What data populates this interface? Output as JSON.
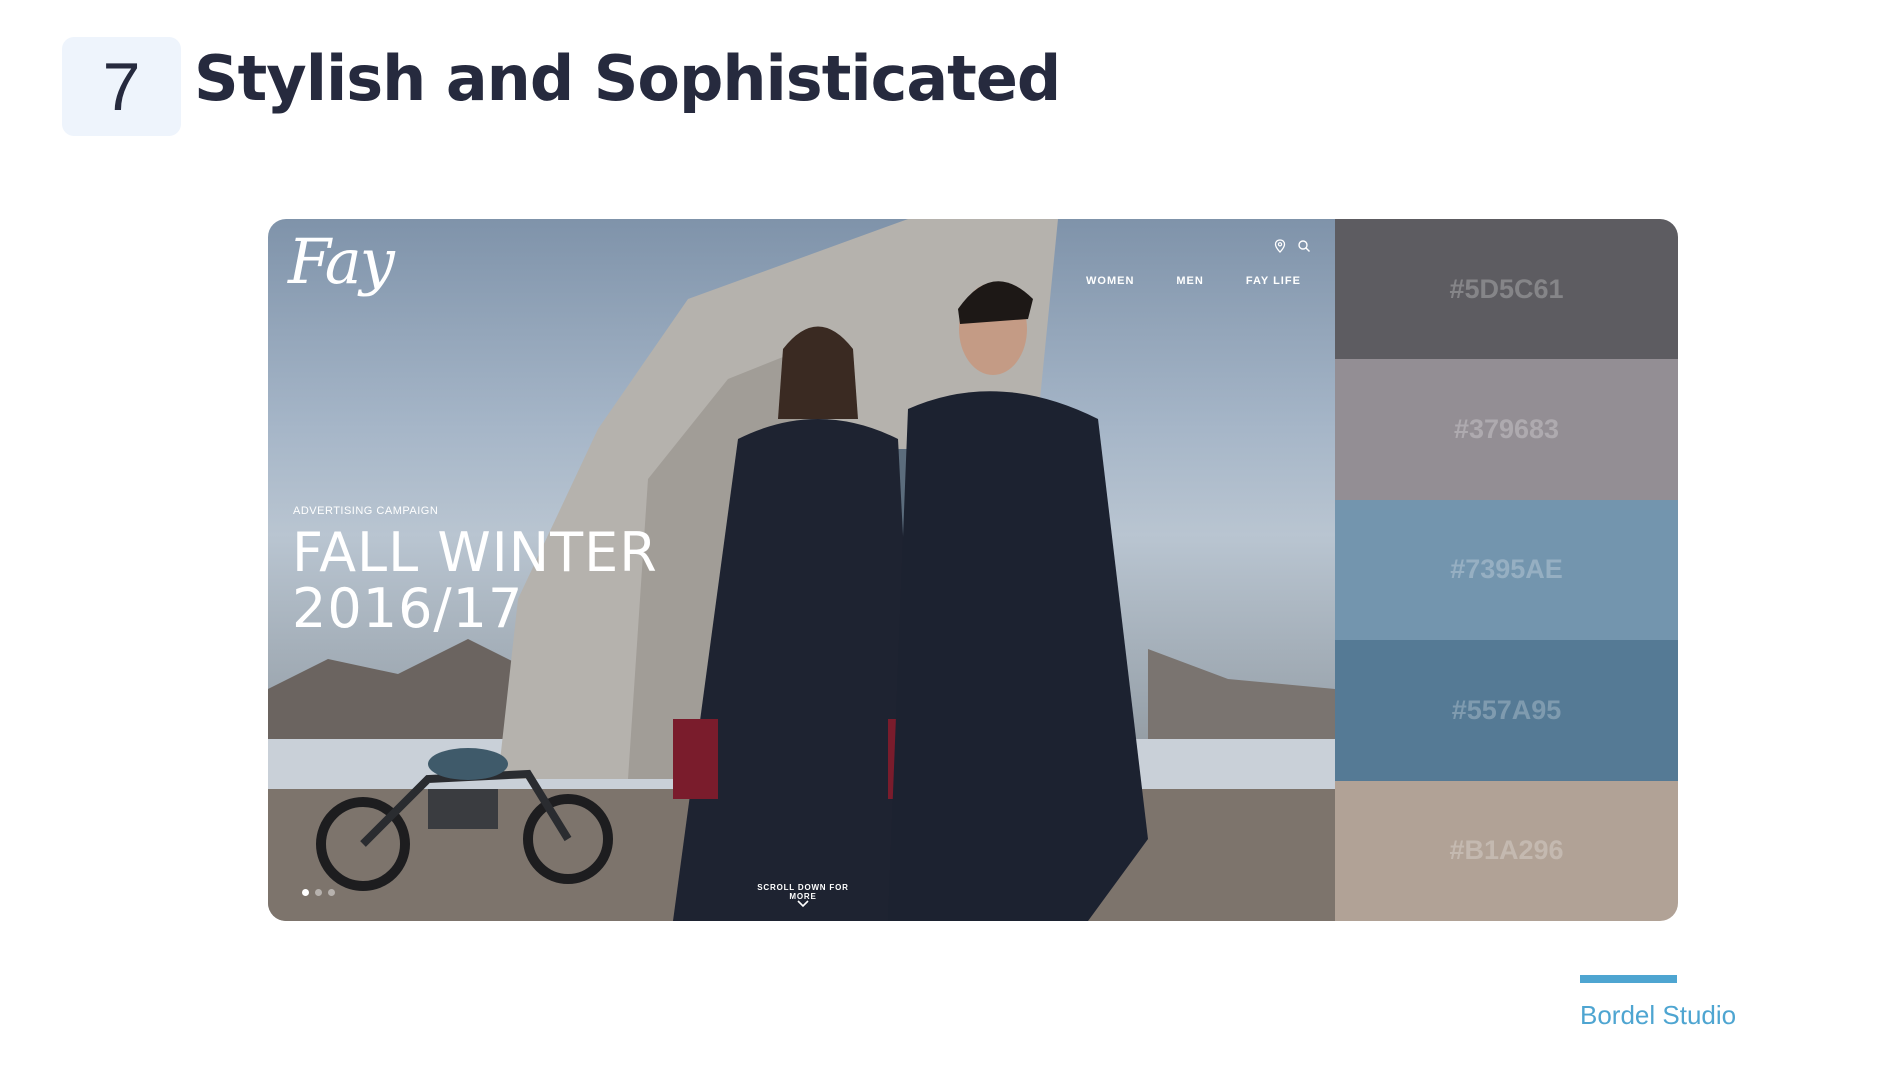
{
  "slide": {
    "number": "7",
    "title": "Stylish and Sophisticated"
  },
  "website": {
    "logo": "Fay",
    "nav_icons": [
      "location-pin-icon",
      "search-icon"
    ],
    "nav": [
      "WOMEN",
      "MEN",
      "FAY LIFE"
    ],
    "campaign_label": "ADVERTISING CAMPAIGN",
    "campaign_title": "FALL WINTER\n2016/17",
    "scroll_hint": "SCROLL DOWN FOR MORE",
    "carousel": {
      "count": 3,
      "active": 1
    }
  },
  "palette": [
    {
      "label": "#5D5C61",
      "color": "#5D5C61"
    },
    {
      "label": "#379683",
      "color": "#938E94"
    },
    {
      "label": "#7395AE",
      "color": "#7395AE"
    },
    {
      "label": "#557A95",
      "color": "#557A95"
    },
    {
      "label": "#B1A296",
      "color": "#B1A296"
    }
  ],
  "footer": {
    "brand": "Bordel Studio"
  },
  "colors": {
    "title": "#262a3e",
    "accent": "#4ea5d1",
    "number_bg": "#eef4fc"
  }
}
